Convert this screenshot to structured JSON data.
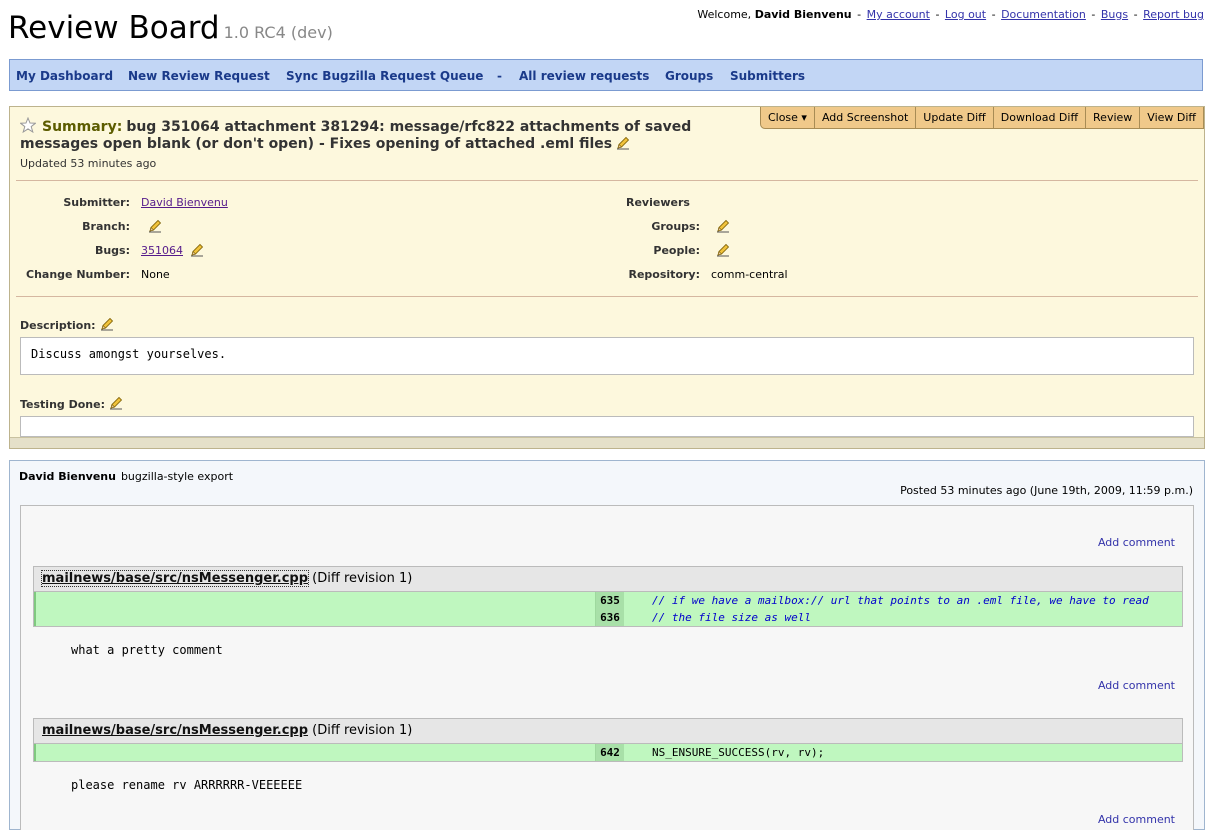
{
  "header": {
    "logo": "Review Board",
    "version": "1.0 RC4 (dev)",
    "welcome_prefix": "Welcome,",
    "user_name": "David Bienvenu",
    "links": [
      "My account",
      "Log out",
      "Documentation",
      "Bugs",
      "Report bug"
    ],
    "separator": "-"
  },
  "nav": {
    "items": [
      "My Dashboard",
      "New Review Request",
      "Sync Bugzilla Request Queue",
      "All review requests",
      "Groups",
      "Submitters"
    ],
    "separator": "-"
  },
  "actions": [
    "Close ▾",
    "Add Screenshot",
    "Update Diff",
    "Download Diff",
    "Review",
    "View Diff"
  ],
  "request": {
    "summary_label": "Summary:",
    "summary": "bug 351064 attachment 381294: message/rfc822 attachments of saved messages open blank (or don't open) - Fixes opening of attached .eml files",
    "updated": "Updated 53 minutes ago",
    "fields": {
      "submitter_label": "Submitter:",
      "submitter": "David Bienvenu",
      "branch_label": "Branch:",
      "bugs_label": "Bugs:",
      "bugs": "351064",
      "change_number_label": "Change Number:",
      "change_number": "None",
      "reviewers_label": "Reviewers",
      "groups_label": "Groups:",
      "people_label": "People:",
      "repository_label": "Repository:",
      "repository": "comm-central"
    },
    "description_label": "Description:",
    "description": "Discuss amongst yourselves.",
    "testing_label": "Testing Done:",
    "testing": ""
  },
  "review": {
    "reviewer": "David Bienvenu",
    "title": "bugzilla-style export",
    "posted": "Posted 53 minutes ago (June 19th, 2009, 11:59 p.m.)",
    "add_comment": "Add comment",
    "diffs": [
      {
        "file": "mailnews/base/src/nsMessenger.cpp",
        "revision": "(Diff revision 1)",
        "lines": [
          {
            "num": "635",
            "code": "// if we have a mailbox:// url that points to an .eml file, we have to read"
          },
          {
            "num": "636",
            "code": "// the file size as well"
          }
        ],
        "comment": "what a pretty comment"
      },
      {
        "file": "mailnews/base/src/nsMessenger.cpp",
        "revision": "(Diff revision 1)",
        "lines": [
          {
            "num": "642",
            "code": "NS_ENSURE_SUCCESS(rv, rv);"
          }
        ],
        "comment": "please rename rv ARRRRRR-VEEEEEE"
      }
    ]
  },
  "colors": {
    "nav_bg": "#c2d6f5",
    "request_bg": "#fdf8dd",
    "action_bg": "#f0c98a",
    "diff_insert_bg": "#bff7bf",
    "link": "#3333aa"
  },
  "icons": [
    "star-icon",
    "pencil-icon"
  ]
}
